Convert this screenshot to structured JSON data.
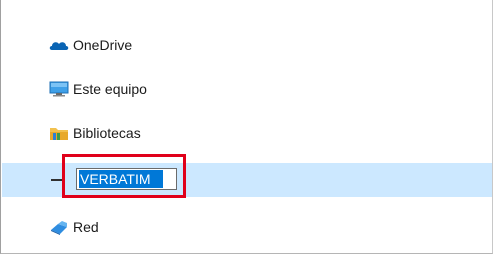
{
  "nav": {
    "items": [
      {
        "label": "OneDrive",
        "icon": "onedrive-cloud-icon"
      },
      {
        "label": "Este equipo",
        "icon": "computer-monitor-icon"
      },
      {
        "label": "Bibliotecas",
        "icon": "libraries-folder-icon"
      },
      {
        "label": "",
        "icon": "usb-drive-icon",
        "rename_value": "VERBATIM",
        "state": "renaming",
        "selected": true
      },
      {
        "label": "Red",
        "icon": "network-icon"
      }
    ]
  },
  "colors": {
    "selection_bg": "#cce8ff",
    "text_selection_bg": "#0078d7",
    "callout_border": "#e0001a",
    "onedrive_blue": "#0a64b4"
  }
}
